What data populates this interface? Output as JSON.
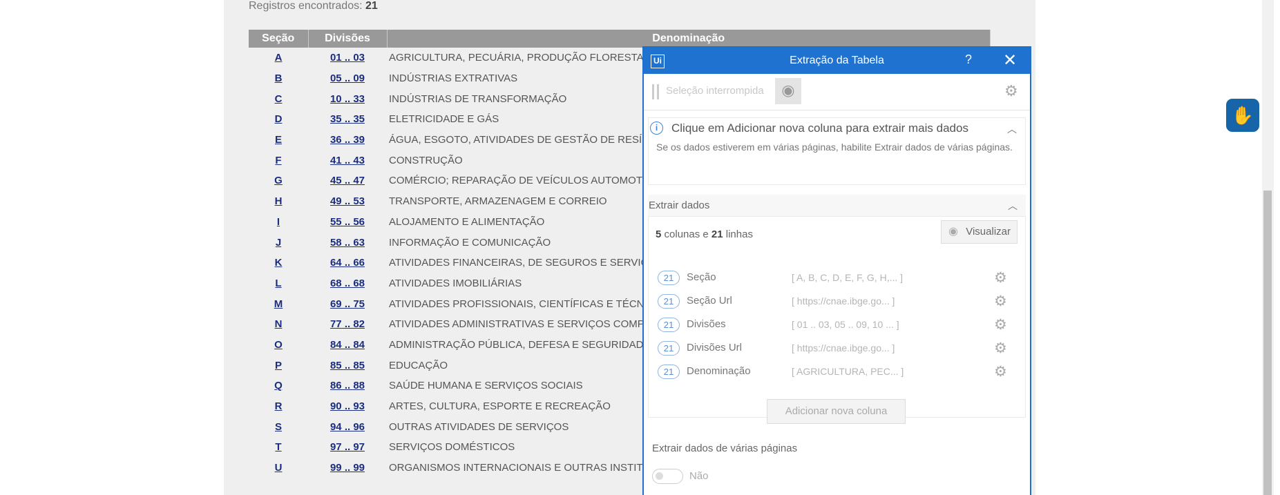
{
  "page": {
    "records_label": "Registros encontrados:",
    "records_count": "21",
    "headers": [
      "Seção",
      "Divisões",
      "Denominação"
    ],
    "rows": [
      {
        "sec": "A",
        "div": "01 .. 03",
        "den": "AGRICULTURA, PECUÁRIA, PRODUÇÃO FLORESTAL"
      },
      {
        "sec": "B",
        "div": "05 .. 09",
        "den": "INDÚSTRIAS EXTRATIVAS"
      },
      {
        "sec": "C",
        "div": "10 .. 33",
        "den": "INDÚSTRIAS DE TRANSFORMAÇÃO"
      },
      {
        "sec": "D",
        "div": "35 .. 35",
        "den": "ELETRICIDADE E GÁS"
      },
      {
        "sec": "E",
        "div": "36 .. 39",
        "den": "ÁGUA, ESGOTO, ATIVIDADES DE GESTÃO DE RESÍD"
      },
      {
        "sec": "F",
        "div": "41 .. 43",
        "den": "CONSTRUÇÃO"
      },
      {
        "sec": "G",
        "div": "45 .. 47",
        "den": "COMÉRCIO; REPARAÇÃO DE VEÍCULOS AUTOMOTO"
      },
      {
        "sec": "H",
        "div": "49 .. 53",
        "den": "TRANSPORTE, ARMAZENAGEM E CORREIO"
      },
      {
        "sec": "I",
        "div": "55 .. 56",
        "den": "ALOJAMENTO E ALIMENTAÇÃO"
      },
      {
        "sec": "J",
        "div": "58 .. 63",
        "den": "INFORMAÇÃO E COMUNICAÇÃO"
      },
      {
        "sec": "K",
        "div": "64 .. 66",
        "den": "ATIVIDADES FINANCEIRAS, DE SEGUROS E SERVIÇO"
      },
      {
        "sec": "L",
        "div": "68 .. 68",
        "den": "ATIVIDADES IMOBILIÁRIAS"
      },
      {
        "sec": "M",
        "div": "69 .. 75",
        "den": "ATIVIDADES PROFISSIONAIS, CIENTÍFICAS E TÉCNIC"
      },
      {
        "sec": "N",
        "div": "77 .. 82",
        "den": "ATIVIDADES ADMINISTRATIVAS E SERVIÇOS COMPLE"
      },
      {
        "sec": "O",
        "div": "84 .. 84",
        "den": "ADMINISTRAÇÃO PÚBLICA, DEFESA E SEGURIDADE"
      },
      {
        "sec": "P",
        "div": "85 .. 85",
        "den": "EDUCAÇÃO"
      },
      {
        "sec": "Q",
        "div": "86 .. 88",
        "den": "SAÚDE HUMANA E SERVIÇOS SOCIAIS"
      },
      {
        "sec": "R",
        "div": "90 .. 93",
        "den": "ARTES, CULTURA, ESPORTE E RECREAÇÃO"
      },
      {
        "sec": "S",
        "div": "94 .. 96",
        "den": "OUTRAS ATIVIDADES DE SERVIÇOS"
      },
      {
        "sec": "T",
        "div": "97 .. 97",
        "den": "SERVIÇOS DOMÉSTICOS"
      },
      {
        "sec": "U",
        "div": "99 .. 99",
        "den": "ORGANISMOS INTERNACIONAIS E OUTRAS INSTITUI"
      }
    ]
  },
  "dialog": {
    "logo": "Ui",
    "title": "Extração da Tabela",
    "help": "?",
    "close": "✕",
    "selection_placeholder": "Seleção interrompida",
    "info_title": "Clique em Adicionar nova coluna para extrair mais dados",
    "info_body": "Se os dados estiverem em várias páginas, habilite Extrair dados de várias páginas.",
    "extract_title": "Extrair dados",
    "summary_cols": "5",
    "summary_cols_label": "colunas e",
    "summary_rows": "21",
    "summary_rows_label": "linhas",
    "preview_button": "Visualizar",
    "columns": [
      {
        "count": "21",
        "name": "Seção",
        "preview": "[ A, B, C, D, E, F, G, H,... ]"
      },
      {
        "count": "21",
        "name": "Seção Url",
        "preview": "[ https://cnae.ibge.go... ]"
      },
      {
        "count": "21",
        "name": "Divisões",
        "preview": "[ 01 .. 03, 05 .. 09, 10 ... ]"
      },
      {
        "count": "21",
        "name": "Divisões Url",
        "preview": "[ https://cnae.ibge.go... ]"
      },
      {
        "count": "21",
        "name": "Denominação",
        "preview": "[ AGRICULTURA, PEC... ]"
      }
    ],
    "add_column_button": "Adicionar nova coluna",
    "multi_page_title": "Extrair dados de várias páginas",
    "multi_page_value": "Não"
  }
}
